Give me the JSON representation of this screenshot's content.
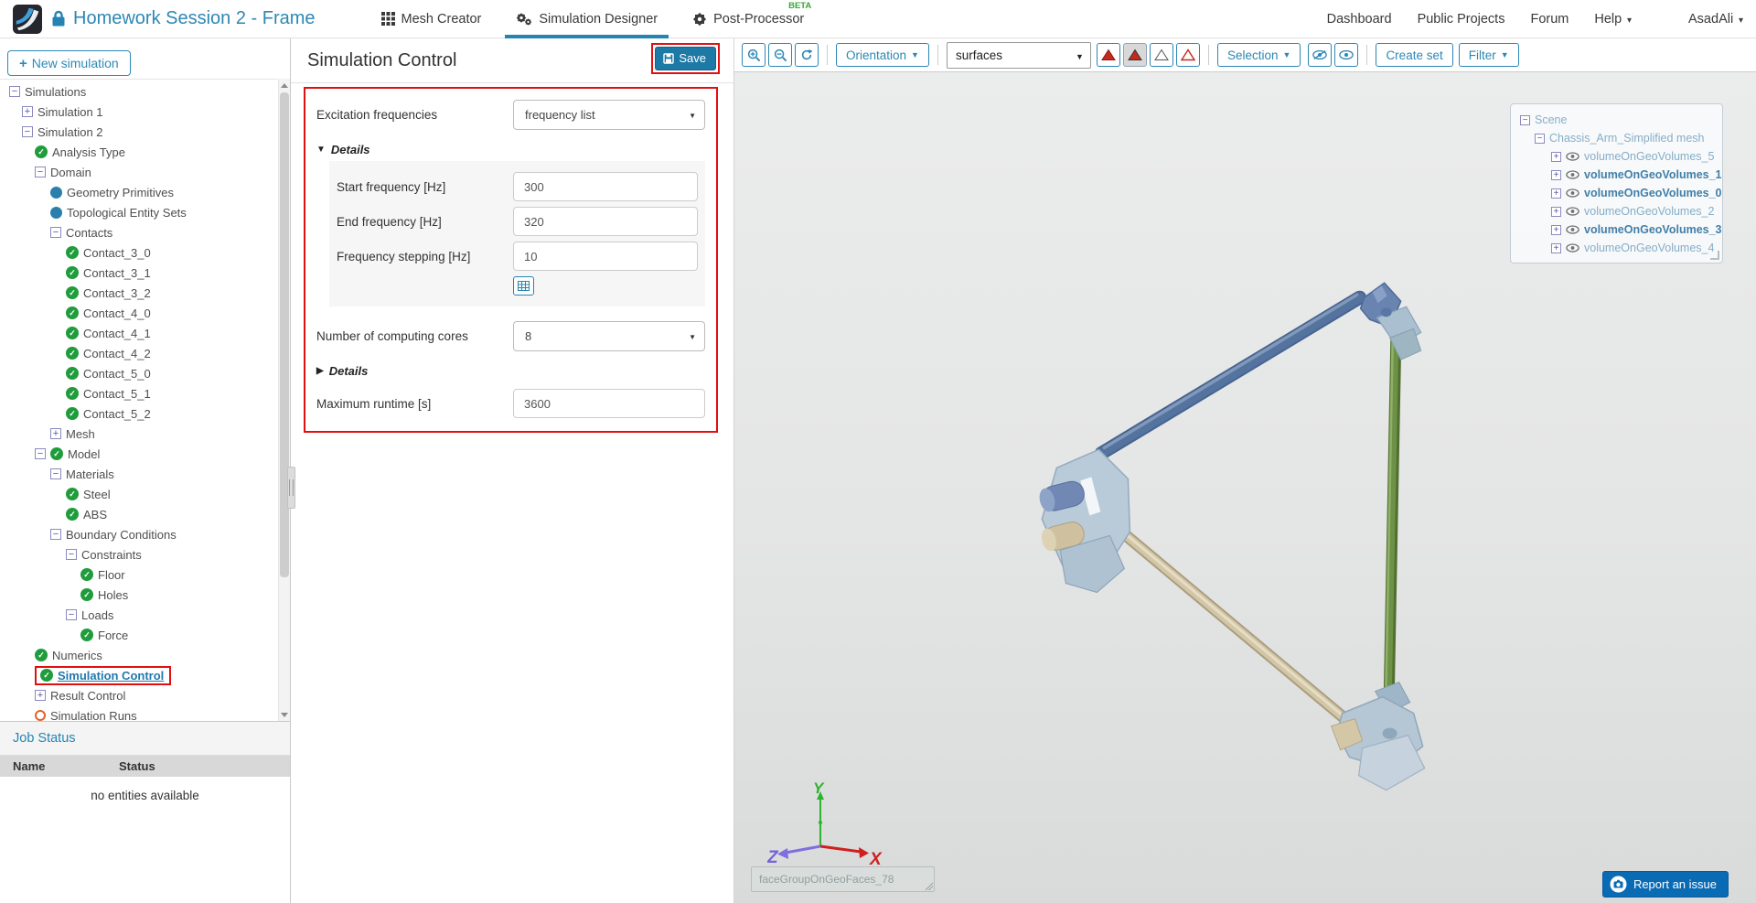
{
  "header": {
    "project_title": "Homework Session 2 - Frame",
    "nav": [
      {
        "label": "Mesh Creator"
      },
      {
        "label": "Simulation Designer",
        "active": true
      },
      {
        "label": "Post-Processor",
        "badge": "BETA"
      }
    ],
    "links": [
      "Dashboard",
      "Public Projects",
      "Forum"
    ],
    "help_label": "Help",
    "user_label": "AsadAli"
  },
  "sidebar": {
    "new_simulation_label": "New simulation",
    "tree": [
      {
        "label": "Simulations",
        "level": 0,
        "icon": "minus"
      },
      {
        "label": "Simulation 1",
        "level": 1,
        "icon": "plus"
      },
      {
        "label": "Simulation 2",
        "level": 1,
        "icon": "minus"
      },
      {
        "label": "Analysis Type",
        "level": 2,
        "icon": "check"
      },
      {
        "label": "Domain",
        "level": 2,
        "icon": "minus"
      },
      {
        "label": "Geometry Primitives",
        "level": 3,
        "icon": "dot"
      },
      {
        "label": "Topological Entity Sets",
        "level": 3,
        "icon": "dot"
      },
      {
        "label": "Contacts",
        "level": 3,
        "icon": "minus"
      },
      {
        "label": "Contact_3_0",
        "level": 4,
        "icon": "check"
      },
      {
        "label": "Contact_3_1",
        "level": 4,
        "icon": "check"
      },
      {
        "label": "Contact_3_2",
        "level": 4,
        "icon": "check"
      },
      {
        "label": "Contact_4_0",
        "level": 4,
        "icon": "check"
      },
      {
        "label": "Contact_4_1",
        "level": 4,
        "icon": "check"
      },
      {
        "label": "Contact_4_2",
        "level": 4,
        "icon": "check"
      },
      {
        "label": "Contact_5_0",
        "level": 4,
        "icon": "check"
      },
      {
        "label": "Contact_5_1",
        "level": 4,
        "icon": "check"
      },
      {
        "label": "Contact_5_2",
        "level": 4,
        "icon": "check"
      },
      {
        "label": "Mesh",
        "level": 3,
        "icon": "plus"
      },
      {
        "label": "Model",
        "level": 2,
        "icon": "minus-check"
      },
      {
        "label": "Materials",
        "level": 3,
        "icon": "minus"
      },
      {
        "label": "Steel",
        "level": 4,
        "icon": "check"
      },
      {
        "label": "ABS",
        "level": 4,
        "icon": "check"
      },
      {
        "label": "Boundary Conditions",
        "level": 3,
        "icon": "minus"
      },
      {
        "label": "Constraints",
        "level": 4,
        "icon": "minus"
      },
      {
        "label": "Floor",
        "level": 5,
        "icon": "check"
      },
      {
        "label": "Holes",
        "level": 5,
        "icon": "check"
      },
      {
        "label": "Loads",
        "level": 4,
        "icon": "minus"
      },
      {
        "label": "Force",
        "level": 5,
        "icon": "check"
      },
      {
        "label": "Numerics",
        "level": 2,
        "icon": "check"
      },
      {
        "label": "Simulation Control",
        "level": 2,
        "icon": "check",
        "selected": true
      },
      {
        "label": "Result Control",
        "level": 2,
        "icon": "plus"
      },
      {
        "label": "Simulation Runs",
        "level": 2,
        "icon": "ring"
      }
    ],
    "job_status": {
      "title": "Job Status",
      "columns": [
        "Name",
        "Status"
      ],
      "empty_message": "no entities available"
    }
  },
  "panel": {
    "title": "Simulation Control",
    "save_label": "Save",
    "fields": {
      "excitation_label": "Excitation frequencies",
      "excitation_value": "frequency list",
      "details_expanded_label": "Details",
      "start_label": "Start frequency [Hz]",
      "start_value": "300",
      "end_label": "End frequency [Hz]",
      "end_value": "320",
      "step_label": "Frequency stepping [Hz]",
      "step_value": "10",
      "cores_label": "Number of computing cores",
      "cores_value": "8",
      "details_collapsed_label": "Details",
      "runtime_label": "Maximum runtime [s]",
      "runtime_value": "3600"
    }
  },
  "viewer": {
    "toolbar": {
      "orientation_label": "Orientation",
      "mode_value": "surfaces",
      "selection_label": "Selection",
      "create_set_label": "Create set",
      "filter_label": "Filter"
    },
    "scene_tree": {
      "root_label": "Scene",
      "mesh_label": "Chassis_Arm_Simplified mesh",
      "volumes": [
        {
          "label": "volumeOnGeoVolumes_5",
          "bold": false
        },
        {
          "label": "volumeOnGeoVolumes_1",
          "bold": true
        },
        {
          "label": "volumeOnGeoVolumes_0",
          "bold": true
        },
        {
          "label": "volumeOnGeoVolumes_2",
          "bold": false
        },
        {
          "label": "volumeOnGeoVolumes_3",
          "bold": true
        },
        {
          "label": "volumeOnGeoVolumes_4",
          "bold": false
        }
      ]
    },
    "axis": {
      "x": "X",
      "y": "Y",
      "z": "Z"
    },
    "face_label": "faceGroupOnGeoFaces_78",
    "report_label": "Report an issue"
  },
  "colors": {
    "accent": "#2585b2",
    "annotation_red": "#e11010",
    "save_button": "#1d79a5",
    "beta_green": "#36a836",
    "check_green": "#1f9c3c",
    "dot_blue": "#2a7fad",
    "pending_orange": "#e2622b",
    "report_blue": "#0a6bb5",
    "rod_blue": "#54749f",
    "rod_green": "#6d9146",
    "rod_tan": "#d2c6a6"
  }
}
